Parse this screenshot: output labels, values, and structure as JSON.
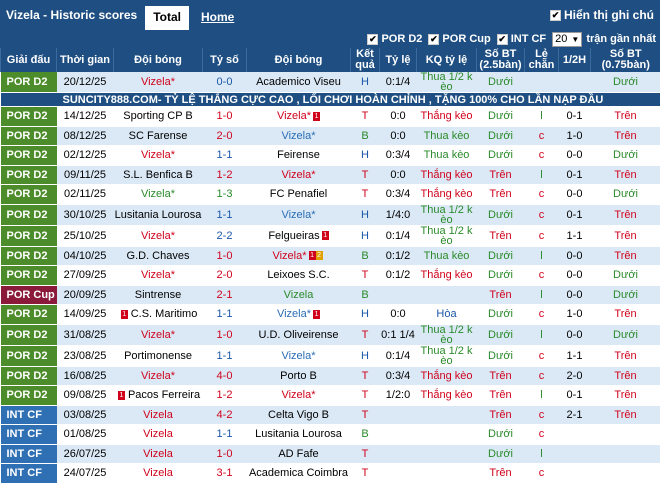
{
  "header": {
    "title": "Vizela - Historic scores",
    "tab_total": "Total",
    "tab_home": "Home",
    "show_note": "Hiển thị ghi chú"
  },
  "filters": {
    "por_d2": "POR D2",
    "por_cup": "POR Cup",
    "int_cf": "INT CF",
    "count": "20",
    "recent": "trận gần nhất"
  },
  "columns": {
    "league": "Giải đấu",
    "time": "Thời gian",
    "home": "Đội bóng",
    "score": "Tỷ số",
    "away": "Đội bóng",
    "result": "Kết quả",
    "odds": "Tỷ lệ",
    "kq_odds": "KQ tỷ lệ",
    "ou": "Số BT (2.5bàn)",
    "oe": "Lẻ chẵn",
    "half": "1/2H",
    "ou2": "Số BT (0.75bàn)"
  },
  "banner": "SUNCITY888.COM- TỶ LỆ THẮNG CỰC CAO , LỐI CHƠI HOÀN CHỈNH , TẶNG 100% CHO LẦN NẠP ĐẦU",
  "rows": [
    {
      "league": "POR D2",
      "lg": "por",
      "date": "20/12/25",
      "home": "Vizela*",
      "hv": true,
      "score": "0-0",
      "sc": "draw",
      "away": "Academico Viseu",
      "av": false,
      "res": "H",
      "odds": "0:1/4",
      "kq": "Thua 1/2 k èo",
      "kqc": "loss",
      "ou": "Dưới",
      "oe": "",
      "half": "",
      "ou2": "Dưới"
    },
    {
      "league": "POR D2",
      "lg": "por",
      "date": "14/12/25",
      "home": "Sporting CP B",
      "hv": false,
      "score": "1-0",
      "sc": "win",
      "away": "Vizela*",
      "av": true,
      "ared": true,
      "res": "T",
      "odds": "0:0",
      "kq": "Thắng kèo",
      "kqc": "win",
      "ou": "Dưới",
      "oe": "l",
      "half": "0-1",
      "ou2": "Trên"
    },
    {
      "league": "POR D2",
      "lg": "por",
      "date": "08/12/25",
      "home": "SC Farense",
      "hv": false,
      "score": "2-0",
      "sc": "win",
      "away": "Vizela*",
      "av": true,
      "avb": true,
      "res": "B",
      "odds": "0:0",
      "kq": "Thua kèo",
      "kqc": "loss",
      "ou": "Dưới",
      "oe": "c",
      "half": "1-0",
      "ou2": "Trên"
    },
    {
      "league": "POR D2",
      "lg": "por",
      "date": "02/12/25",
      "home": "Vizela*",
      "hv": true,
      "score": "1-1",
      "sc": "draw",
      "away": "Feirense",
      "av": false,
      "res": "H",
      "odds": "0:3/4",
      "kq": "Thua kèo",
      "kqc": "loss",
      "ou": "Dưới",
      "oe": "c",
      "half": "0-0",
      "ou2": "Dưới"
    },
    {
      "league": "POR D2",
      "lg": "por",
      "date": "09/11/25",
      "home": "S.L. Benfica B",
      "hv": false,
      "score": "1-2",
      "sc": "win",
      "away": "Vizela*",
      "av": true,
      "res": "T",
      "odds": "0:0",
      "kq": "Thắng kèo",
      "kqc": "win",
      "ou": "Trên",
      "oe": "l",
      "half": "0-1",
      "ou2": "Trên"
    },
    {
      "league": "POR D2",
      "lg": "por",
      "date": "02/11/25",
      "home": "Vizela*",
      "hv": true,
      "hg": true,
      "score": "1-3",
      "sc": "loss",
      "away": "FC Penafiel",
      "av": false,
      "res": "T",
      "odds": "0:3/4",
      "kq": "Thắng kèo",
      "kqc": "win",
      "ou": "Trên",
      "oe": "c",
      "half": "0-0",
      "ou2": "Dưới"
    },
    {
      "league": "POR D2",
      "lg": "por",
      "date": "30/10/25",
      "home": "Lusitania Lourosa",
      "hv": false,
      "score": "1-1",
      "sc": "draw",
      "away": "Vizela*",
      "av": true,
      "avb": true,
      "res": "H",
      "odds": "1/4:0",
      "kq": "Thua 1/2 k èo",
      "kqc": "loss",
      "ou": "Dưới",
      "oe": "c",
      "half": "0-1",
      "ou2": "Trên"
    },
    {
      "league": "POR D2",
      "lg": "por",
      "date": "25/10/25",
      "home": "Vizela*",
      "hv": true,
      "score": "2-2",
      "sc": "draw",
      "away": "Felgueiras",
      "av": false,
      "ared": true,
      "res": "H",
      "odds": "0:1/4",
      "kq": "Thua 1/2 k èo",
      "kqc": "loss",
      "ou": "Trên",
      "oe": "c",
      "half": "1-1",
      "ou2": "Trên"
    },
    {
      "league": "POR D2",
      "lg": "por",
      "date": "04/10/25",
      "home": "G.D. Chaves",
      "hv": false,
      "score": "1-0",
      "sc": "win",
      "away": "Vizela*",
      "av": true,
      "ared": true,
      "ared2": true,
      "res": "B",
      "odds": "0:1/2",
      "kq": "Thua kèo",
      "kqc": "loss",
      "ou": "Dưới",
      "oe": "l",
      "half": "0-0",
      "ou2": "Trên"
    },
    {
      "league": "POR D2",
      "lg": "por",
      "date": "27/09/25",
      "home": "Vizela*",
      "hv": true,
      "score": "2-0",
      "sc": "win",
      "away": "Leixoes S.C.",
      "av": false,
      "res": "T",
      "odds": "0:1/2",
      "kq": "Thắng kèo",
      "kqc": "win",
      "ou": "Dưới",
      "oe": "c",
      "half": "0-0",
      "ou2": "Dưới"
    },
    {
      "league": "POR Cup",
      "lg": "cup",
      "date": "20/09/25",
      "home": "Sintrense",
      "hv": false,
      "score": "2-1",
      "sc": "win",
      "away": "Vizela",
      "av": true,
      "avg": true,
      "res": "B",
      "odds": "",
      "kq": "",
      "kqc": "",
      "ou": "Trên",
      "oe": "l",
      "half": "0-0",
      "ou2": "Dưới"
    },
    {
      "league": "POR D2",
      "lg": "por",
      "date": "14/09/25",
      "home": "C.S. Maritimo",
      "hv": false,
      "hred": true,
      "score": "1-1",
      "sc": "draw",
      "away": "Vizela*",
      "av": true,
      "avb": true,
      "ared": true,
      "res": "H",
      "odds": "0:0",
      "kq": "Hòa",
      "kqc": "draw",
      "ou": "Dưới",
      "oe": "c",
      "half": "1-0",
      "ou2": "Trên"
    },
    {
      "league": "POR D2",
      "lg": "por",
      "date": "31/08/25",
      "home": "Vizela*",
      "hv": true,
      "score": "1-0",
      "sc": "win",
      "away": "U.D. Oliveirense",
      "av": false,
      "res": "T",
      "odds": "0:1 1/4",
      "kq": "Thua 1/2 k èo",
      "kqc": "loss",
      "ou": "Dưới",
      "oe": "l",
      "half": "0-0",
      "ou2": "Dưới"
    },
    {
      "league": "POR D2",
      "lg": "por",
      "date": "23/08/25",
      "home": "Portimonense",
      "hv": false,
      "score": "1-1",
      "sc": "draw",
      "away": "Vizela*",
      "av": true,
      "avb": true,
      "res": "H",
      "odds": "0:1/4",
      "kq": "Thua 1/2 k èo",
      "kqc": "loss",
      "ou": "Dưới",
      "oe": "c",
      "half": "1-1",
      "ou2": "Trên"
    },
    {
      "league": "POR D2",
      "lg": "por",
      "date": "16/08/25",
      "home": "Vizela*",
      "hv": true,
      "score": "4-0",
      "sc": "win",
      "away": "Porto B",
      "av": false,
      "res": "T",
      "odds": "0:3/4",
      "kq": "Thắng kèo",
      "kqc": "win",
      "ou": "Trên",
      "oe": "c",
      "half": "2-0",
      "ou2": "Trên"
    },
    {
      "league": "POR D2",
      "lg": "por",
      "date": "09/08/25",
      "home": "Pacos Ferreira",
      "hv": false,
      "hred": true,
      "score": "1-2",
      "sc": "win",
      "away": "Vizela*",
      "av": true,
      "res": "T",
      "odds": "1/2:0",
      "kq": "Thắng kèo",
      "kqc": "win",
      "ou": "Trên",
      "oe": "l",
      "half": "0-1",
      "ou2": "Trên"
    },
    {
      "league": "INT CF",
      "lg": "int",
      "date": "03/08/25",
      "home": "Vizela",
      "hv": true,
      "score": "4-2",
      "sc": "win",
      "away": "Celta Vigo B",
      "av": false,
      "res": "T",
      "odds": "",
      "kq": "",
      "kqc": "",
      "ou": "Trên",
      "oe": "c",
      "half": "2-1",
      "ou2": "Trên"
    },
    {
      "league": "INT CF",
      "lg": "int",
      "date": "01/08/25",
      "home": "Vizela",
      "hv": true,
      "score": "1-1",
      "sc": "draw",
      "away": "Lusitania Lourosa",
      "av": false,
      "res": "B",
      "odds": "",
      "kq": "",
      "kqc": "",
      "ou": "Dưới",
      "oe": "c",
      "half": "",
      "ou2": ""
    },
    {
      "league": "INT CF",
      "lg": "int",
      "date": "26/07/25",
      "home": "Vizela",
      "hv": true,
      "score": "1-0",
      "sc": "win",
      "away": "AD Fafe",
      "av": false,
      "res": "T",
      "odds": "",
      "kq": "",
      "kqc": "",
      "ou": "Dưới",
      "oe": "l",
      "half": "",
      "ou2": ""
    },
    {
      "league": "INT CF",
      "lg": "int",
      "date": "24/07/25",
      "home": "Vizela",
      "hv": true,
      "score": "3-1",
      "sc": "win",
      "away": "Academica Coimbra",
      "av": false,
      "res": "T",
      "odds": "",
      "kq": "",
      "kqc": "",
      "ou": "Trên",
      "oe": "c",
      "half": "",
      "ou2": ""
    }
  ]
}
